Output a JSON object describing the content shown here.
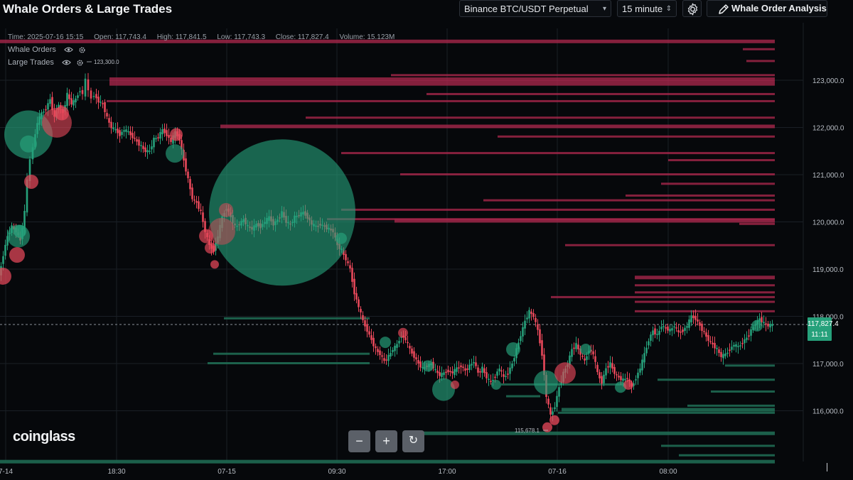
{
  "header": {
    "title": "Whale Orders & Large Trades",
    "market_select": "Binance BTC/USDT Perpetual",
    "interval_select": "15 minute",
    "analysis_button": "Whale Order Analysis"
  },
  "legend": {
    "time": "Time: 2025-07-16 15:15",
    "open": "Open: 117,743.4",
    "high": "High: 117,841.5",
    "low": "Low: 117,743.3",
    "close": "Close: 117,827.4",
    "volume": "Volume: 15.123M",
    "series": [
      "Whale Orders",
      "Large Trades"
    ]
  },
  "price_axis": {
    "labels": [
      "123,000.0",
      "122,000.0",
      "121,000.0",
      "120,000.0",
      "119,000.0",
      "118,000.0",
      "117,000.0",
      "116,000.0"
    ],
    "current_price": "117,827.4",
    "countdown": "11:11"
  },
  "time_axis": {
    "labels": [
      "7-14",
      "18:30",
      "07-15",
      "09:30",
      "17:00",
      "07-16",
      "08:00"
    ]
  },
  "annotations": {
    "high_label": "123,300.0",
    "low_label": "115,678.1"
  },
  "zoom": {
    "minus": "−",
    "plus": "+",
    "reset": "↻"
  },
  "brand": "coinglass",
  "colors": {
    "bull": "#26a17b",
    "bear": "#e8485a",
    "ask_wall": "#b0284f",
    "bid_wall": "#1f6a52",
    "accent": "#26a17b"
  },
  "chart_data": {
    "type": "candlestick",
    "ylim": [
      115300,
      123900
    ],
    "y_ticks": [
      123000,
      122000,
      121000,
      120000,
      119000,
      118000,
      117000,
      116000
    ],
    "current_price": 117827.4,
    "price_path": [
      [
        0,
        118850
      ],
      [
        6,
        119300
      ],
      [
        12,
        119700
      ],
      [
        18,
        119900
      ],
      [
        24,
        119800
      ],
      [
        30,
        119600
      ],
      [
        36,
        120200
      ],
      [
        40,
        120900
      ],
      [
        44,
        121300
      ],
      [
        48,
        121600
      ],
      [
        54,
        122100
      ],
      [
        60,
        122300
      ],
      [
        66,
        122400
      ],
      [
        72,
        122600
      ],
      [
        78,
        122200
      ],
      [
        84,
        122500
      ],
      [
        90,
        122300
      ],
      [
        96,
        122700
      ],
      [
        102,
        122500
      ],
      [
        108,
        122600
      ],
      [
        114,
        122800
      ],
      [
        118,
        122700
      ],
      [
        122,
        123000
      ],
      [
        126,
        122800
      ],
      [
        130,
        122600
      ],
      [
        134,
        122700
      ],
      [
        140,
        122550
      ],
      [
        146,
        122500
      ],
      [
        152,
        122200
      ],
      [
        158,
        122000
      ],
      [
        164,
        121950
      ],
      [
        170,
        121850
      ],
      [
        176,
        121950
      ],
      [
        182,
        121900
      ],
      [
        188,
        121800
      ],
      [
        194,
        121700
      ],
      [
        200,
        121600
      ],
      [
        206,
        121500
      ],
      [
        212,
        121500
      ],
      [
        218,
        121750
      ],
      [
        224,
        121800
      ],
      [
        230,
        121950
      ],
      [
        236,
        121850
      ],
      [
        242,
        121700
      ],
      [
        248,
        121900
      ],
      [
        254,
        121750
      ],
      [
        260,
        121300
      ],
      [
        266,
        120900
      ],
      [
        272,
        120500
      ],
      [
        278,
        120400
      ],
      [
        284,
        120200
      ],
      [
        290,
        119800
      ],
      [
        296,
        119500
      ],
      [
        302,
        119400
      ],
      [
        308,
        119700
      ],
      [
        314,
        120100
      ],
      [
        320,
        120300
      ],
      [
        326,
        120100
      ],
      [
        332,
        119900
      ],
      [
        338,
        119950
      ],
      [
        344,
        120050
      ],
      [
        350,
        119900
      ],
      [
        356,
        119850
      ],
      [
        362,
        119950
      ],
      [
        368,
        119900
      ],
      [
        374,
        120000
      ],
      [
        380,
        120100
      ],
      [
        386,
        119950
      ],
      [
        392,
        120050
      ],
      [
        398,
        120200
      ],
      [
        404,
        120000
      ],
      [
        410,
        119950
      ],
      [
        416,
        120100
      ],
      [
        422,
        120150
      ],
      [
        428,
        120200
      ],
      [
        434,
        120100
      ],
      [
        440,
        119950
      ],
      [
        446,
        119900
      ],
      [
        452,
        119950
      ],
      [
        458,
        119900
      ],
      [
        464,
        119850
      ],
      [
        470,
        119800
      ],
      [
        476,
        119500
      ],
      [
        482,
        119400
      ],
      [
        488,
        119200
      ],
      [
        494,
        119000
      ],
      [
        500,
        118500
      ],
      [
        506,
        118200
      ],
      [
        512,
        117900
      ],
      [
        518,
        117700
      ],
      [
        524,
        117500
      ],
      [
        530,
        117300
      ],
      [
        536,
        117200
      ],
      [
        542,
        117050
      ],
      [
        548,
        117150
      ],
      [
        554,
        117300
      ],
      [
        560,
        117400
      ],
      [
        566,
        117600
      ],
      [
        572,
        117500
      ],
      [
        578,
        117300
      ],
      [
        584,
        117150
      ],
      [
        590,
        117000
      ],
      [
        596,
        116900
      ],
      [
        602,
        116950
      ],
      [
        608,
        117000
      ],
      [
        614,
        116850
      ],
      [
        620,
        116750
      ],
      [
        626,
        116800
      ],
      [
        632,
        116850
      ],
      [
        638,
        116800
      ],
      [
        644,
        116900
      ],
      [
        650,
        116950
      ],
      [
        656,
        116850
      ],
      [
        662,
        116950
      ],
      [
        668,
        117050
      ],
      [
        674,
        116800
      ],
      [
        680,
        116900
      ],
      [
        686,
        116700
      ],
      [
        692,
        116600
      ],
      [
        698,
        116750
      ],
      [
        704,
        116900
      ],
      [
        710,
        116700
      ],
      [
        716,
        116800
      ],
      [
        722,
        117000
      ],
      [
        728,
        117300
      ],
      [
        734,
        117600
      ],
      [
        740,
        117900
      ],
      [
        746,
        118100
      ],
      [
        752,
        118000
      ],
      [
        758,
        117700
      ],
      [
        764,
        117200
      ],
      [
        770,
        116300
      ],
      [
        776,
        115900
      ],
      [
        782,
        116100
      ],
      [
        788,
        116500
      ],
      [
        794,
        116800
      ],
      [
        800,
        117000
      ],
      [
        806,
        117300
      ],
      [
        812,
        117400
      ],
      [
        818,
        117200
      ],
      [
        824,
        117050
      ],
      [
        830,
        117300
      ],
      [
        836,
        117200
      ],
      [
        842,
        116800
      ],
      [
        848,
        116600
      ],
      [
        854,
        116900
      ],
      [
        860,
        117000
      ],
      [
        866,
        116800
      ],
      [
        872,
        116700
      ],
      [
        878,
        116650
      ],
      [
        884,
        116700
      ],
      [
        890,
        116500
      ],
      [
        896,
        116700
      ],
      [
        902,
        116900
      ],
      [
        908,
        117200
      ],
      [
        914,
        117500
      ],
      [
        920,
        117700
      ],
      [
        926,
        117600
      ],
      [
        932,
        117800
      ],
      [
        938,
        117750
      ],
      [
        944,
        117700
      ],
      [
        950,
        117800
      ],
      [
        956,
        117650
      ],
      [
        962,
        117700
      ],
      [
        968,
        117800
      ],
      [
        974,
        118000
      ],
      [
        980,
        117950
      ],
      [
        986,
        117800
      ],
      [
        992,
        117650
      ],
      [
        998,
        117500
      ],
      [
        1004,
        117400
      ],
      [
        1010,
        117300
      ],
      [
        1016,
        117150
      ],
      [
        1022,
        117200
      ],
      [
        1028,
        117300
      ],
      [
        1034,
        117400
      ],
      [
        1040,
        117350
      ],
      [
        1046,
        117450
      ],
      [
        1052,
        117550
      ],
      [
        1058,
        117700
      ],
      [
        1064,
        117850
      ],
      [
        1070,
        117950
      ],
      [
        1076,
        117850
      ],
      [
        1082,
        117800
      ],
      [
        1088,
        117827
      ]
    ],
    "ask_walls": [
      [
        123000,
        154,
        1090,
        2
      ],
      [
        122900,
        154,
        1090,
        3
      ],
      [
        122550,
        150,
        1090,
        1
      ],
      [
        122200,
        430,
        1090,
        1
      ],
      [
        122000,
        310,
        1090,
        2
      ],
      [
        121450,
        480,
        1090,
        1
      ],
      [
        121000,
        563,
        1090,
        1
      ],
      [
        120550,
        880,
        1090,
        1
      ],
      [
        120450,
        680,
        1090,
        1
      ],
      [
        120250,
        480,
        1090,
        1
      ],
      [
        120050,
        460,
        1090,
        1
      ],
      [
        120000,
        555,
        1090,
        2
      ],
      [
        119950,
        1040,
        1090,
        1
      ],
      [
        119500,
        795,
        1090,
        1
      ],
      [
        118800,
        893,
        1090,
        2
      ],
      [
        118650,
        893,
        1090,
        1
      ],
      [
        118500,
        893,
        1090,
        1
      ],
      [
        118400,
        775,
        1090,
        1
      ],
      [
        118300,
        893,
        1090,
        1
      ],
      [
        118100,
        893,
        1090,
        1
      ],
      [
        123800,
        0,
        1090,
        2
      ],
      [
        123650,
        1045,
        1090,
        1
      ],
      [
        123400,
        1050,
        1090,
        1
      ],
      [
        123100,
        550,
        1090,
        1
      ],
      [
        122700,
        600,
        1090,
        1
      ],
      [
        121800,
        700,
        1090,
        1
      ],
      [
        121300,
        940,
        1090,
        1
      ],
      [
        120800,
        930,
        1090,
        1
      ]
    ],
    "bid_walls": [
      [
        117000,
        292,
        520,
        1
      ],
      [
        117200,
        300,
        520,
        1
      ],
      [
        117950,
        315,
        520,
        1
      ],
      [
        116950,
        1020,
        1090,
        1
      ],
      [
        116650,
        925,
        1090,
        1
      ],
      [
        116400,
        1000,
        1090,
        1
      ],
      [
        116000,
        790,
        1090,
        2
      ],
      [
        115950,
        785,
        1090,
        1
      ],
      [
        115500,
        580,
        1090,
        2
      ],
      [
        115250,
        930,
        1090,
        1
      ],
      [
        115050,
        955,
        1090,
        1
      ],
      [
        114900,
        0,
        1090,
        2
      ],
      [
        116550,
        705,
        880,
        1
      ],
      [
        116300,
        712,
        760,
        1
      ],
      [
        116100,
        967,
        1090,
        1
      ]
    ],
    "bubbles": [
      [
        40,
        121850,
        34,
        "bull",
        0.75
      ],
      [
        40,
        121650,
        12,
        "bull",
        0.8
      ],
      [
        80,
        122100,
        21,
        "bear",
        0.7
      ],
      [
        87,
        122300,
        10,
        "bear",
        0.85
      ],
      [
        44,
        120850,
        10,
        "bear",
        0.85
      ],
      [
        26,
        119700,
        16,
        "bull",
        0.75
      ],
      [
        28,
        119800,
        9,
        "bull",
        0.9
      ],
      [
        24,
        119300,
        11,
        "bear",
        0.85
      ],
      [
        246,
        121450,
        13,
        "bull",
        0.75
      ],
      [
        248,
        121850,
        9,
        "bear",
        0.85
      ],
      [
        397,
        120200,
        103,
        "bull",
        0.72
      ],
      [
        312,
        119800,
        19,
        "bear",
        0.55
      ],
      [
        318,
        120250,
        10,
        "bear",
        0.6
      ],
      [
        296,
        119450,
        8,
        "bear",
        0.8
      ],
      [
        302,
        119100,
        6,
        "bear",
        0.85
      ],
      [
        290,
        119700,
        10,
        "bear",
        0.8
      ],
      [
        542,
        117450,
        8,
        "bull",
        0.8
      ],
      [
        567,
        117650,
        7,
        "bear",
        0.8
      ],
      [
        602,
        116950,
        8,
        "bull",
        0.8
      ],
      [
        624,
        116450,
        16,
        "bull",
        0.75
      ],
      [
        698,
        116550,
        7,
        "bull",
        0.8
      ],
      [
        722,
        117300,
        10,
        "bull",
        0.8
      ],
      [
        768,
        116600,
        17,
        "bull",
        0.75
      ],
      [
        795,
        116800,
        15,
        "bear",
        0.75
      ],
      [
        780,
        115800,
        7,
        "bear",
        0.9
      ],
      [
        770,
        115650,
        7,
        "bear",
        0.9
      ],
      [
        873,
        116500,
        8,
        "bull",
        0.8
      ],
      [
        884,
        116550,
        7,
        "bear",
        0.85
      ],
      [
        824,
        117300,
        8,
        "bull",
        0.8
      ],
      [
        1065,
        117800,
        8,
        "bull",
        0.8
      ],
      [
        4,
        118850,
        12,
        "bear",
        0.85
      ],
      [
        480,
        119650,
        8,
        "bull",
        0.8
      ],
      [
        640,
        116550,
        6,
        "bear",
        0.8
      ]
    ]
  }
}
